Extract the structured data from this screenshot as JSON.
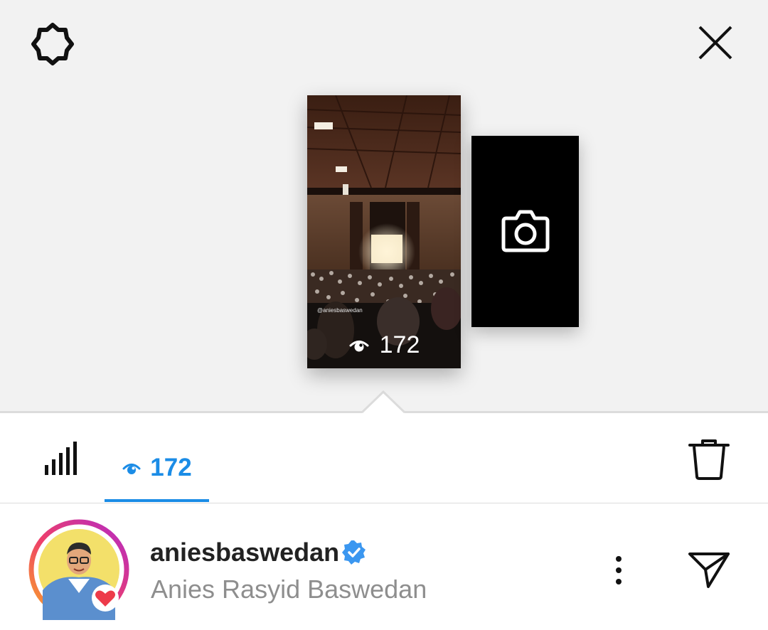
{
  "header": {
    "settings_icon": "gear-icon",
    "close_icon": "close-icon"
  },
  "stories": [
    {
      "type": "photo",
      "description": "concert hall crowd",
      "watermark": "@aniesbaswedan",
      "views": "172",
      "views_icon": "eye-icon"
    },
    {
      "type": "add-story",
      "icon": "camera-icon"
    }
  ],
  "tabs": {
    "insights_icon": "bar-chart-icon",
    "viewers_count": "172",
    "viewers_icon": "eye-icon",
    "delete_icon": "trash-icon",
    "active_color": "#1b8ce6"
  },
  "viewer": {
    "username": "aniesbaswedan",
    "full_name": "Anies Rasyid Baswedan",
    "verified": true,
    "liked": true,
    "more_icon": "more-vertical-icon",
    "send_icon": "send-icon"
  }
}
